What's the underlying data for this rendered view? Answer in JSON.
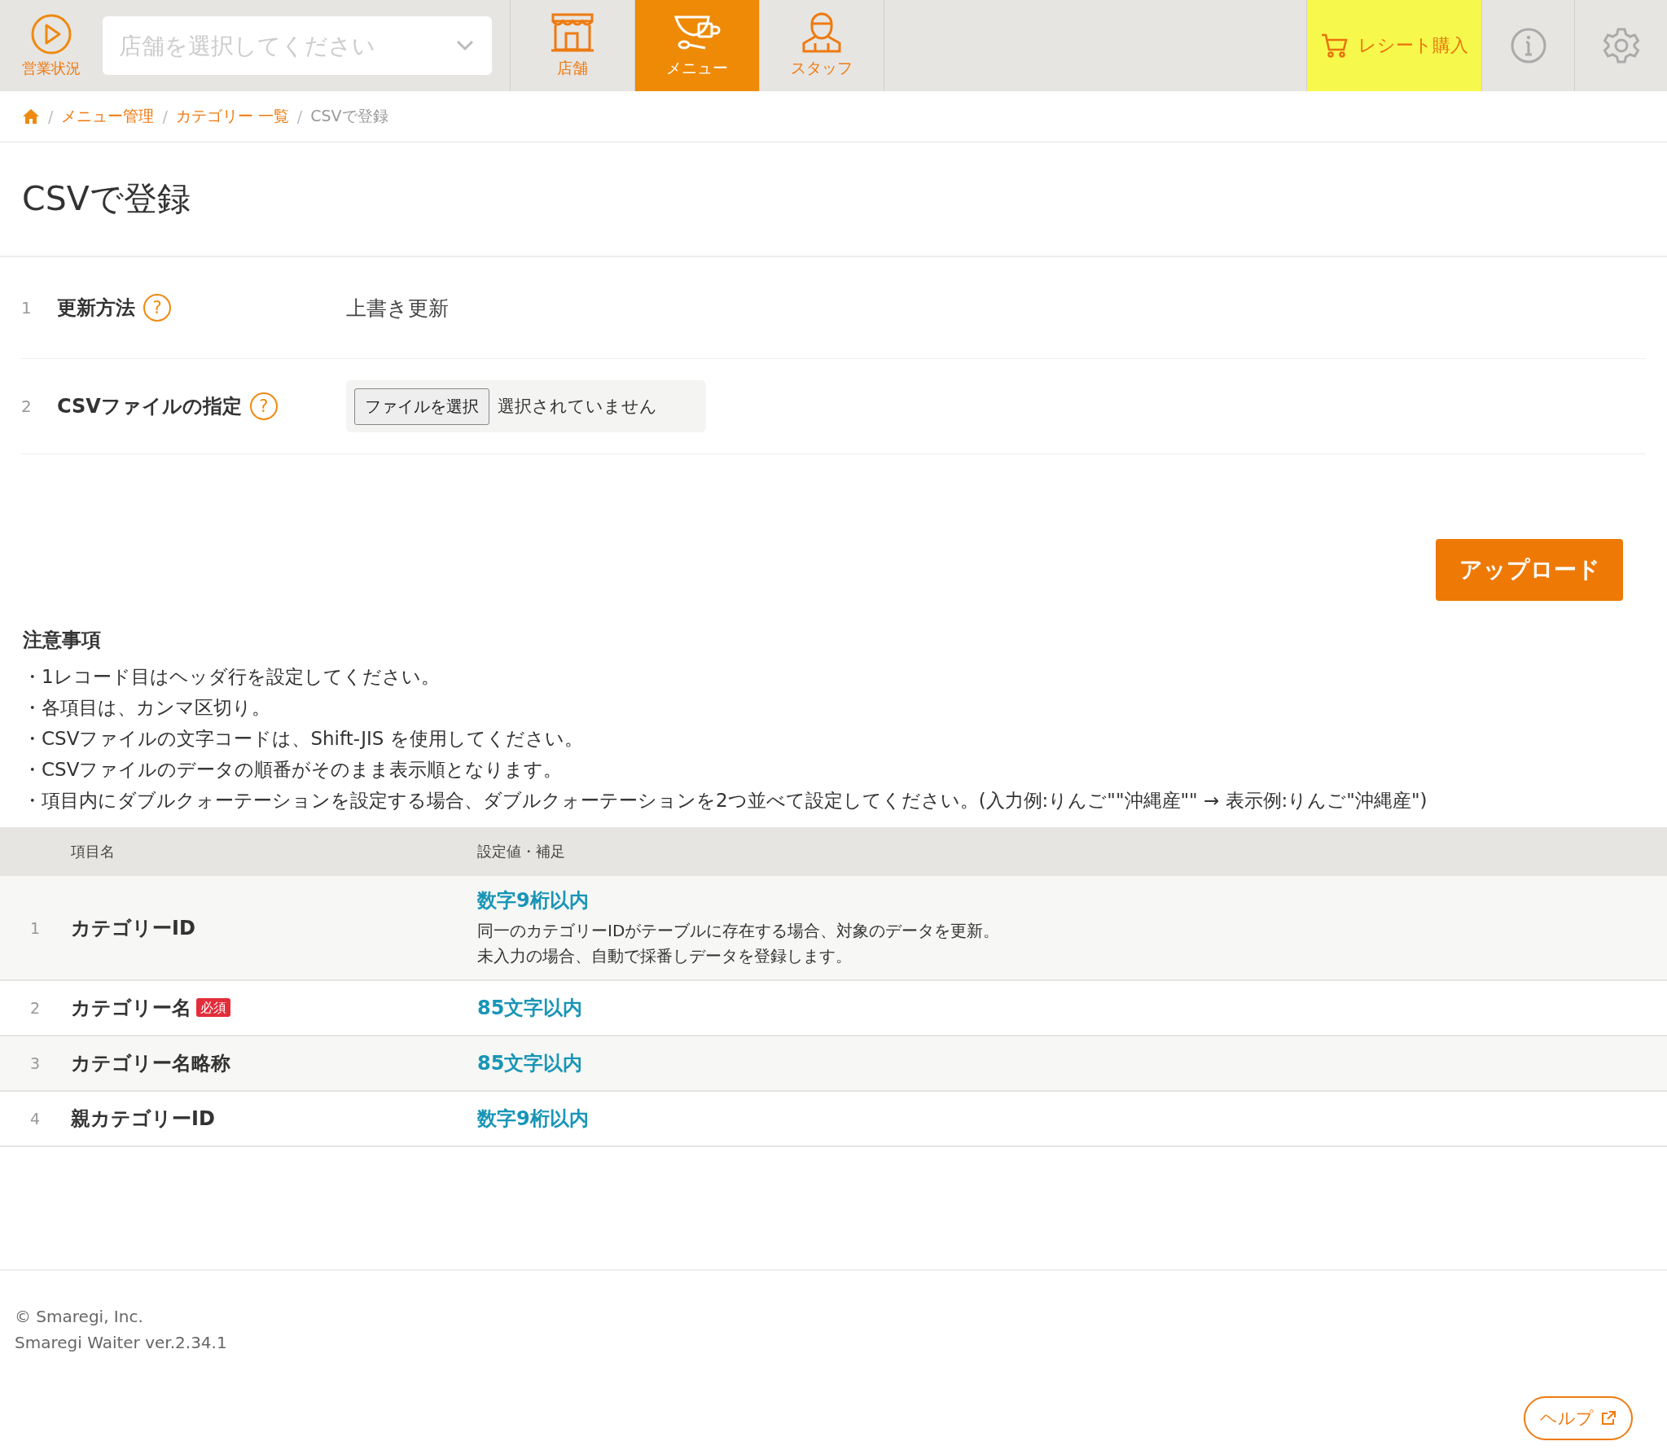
{
  "header": {
    "status_button": {
      "label": "営業状況"
    },
    "store_select": {
      "placeholder": "店舗を選択してください"
    },
    "tabs": [
      {
        "label": "店舗",
        "kind": "store",
        "selected": false
      },
      {
        "label": "メニュー",
        "kind": "menu",
        "selected": true
      },
      {
        "label": "スタッフ",
        "kind": "staff",
        "selected": false
      }
    ],
    "receipt_button": {
      "label": "レシート購入"
    }
  },
  "breadcrumb": [
    {
      "separator": "/",
      "label": "メニュー管理",
      "kind": "link"
    },
    {
      "separator": "/",
      "label": "カテゴリー 一覧",
      "kind": "link"
    },
    {
      "separator": "/",
      "label": "CSVで登録",
      "kind": "current"
    }
  ],
  "page_title": "CSVで登録",
  "form": [
    {
      "number": "1",
      "label": "更新方法",
      "help": "?",
      "kind": "text",
      "value": "上書き更新"
    },
    {
      "number": "2",
      "label": "CSVファイルの指定",
      "help": "?",
      "kind": "file",
      "button": "ファイルを選択",
      "value": "選択されていません"
    }
  ],
  "upload_button": "アップロード",
  "notes": {
    "title": "注意事項",
    "items": [
      "・1レコード目はヘッダ行を設定してください。",
      "・各項目は、カンマ区切り。",
      "・CSVファイルの文字コードは、Shift-JIS を使用してください。",
      "・CSVファイルのデータの順番がそのまま表示順となります。",
      "・項目内にダブルクォーテーションを設定する場合、ダブルクォーテーションを2つ並べて設定してください。(入力例:りんご\"\"沖縄産\"\" → 表示例:りんご\"沖縄産\")"
    ]
  },
  "table": {
    "columns": [
      "項目名",
      "設定値・補足"
    ],
    "rows": [
      {
        "number": "1",
        "name": "カテゴリーID",
        "limit": "数字9桁以内",
        "notes": [
          "同一のカテゴリーIDがテーブルに存在する場合、対象のデータを更新。",
          "未入力の場合、自動で採番しデータを登録します。"
        ]
      },
      {
        "number": "2",
        "name": "カテゴリー名",
        "badge": "必須",
        "limit": "85文字以内"
      },
      {
        "number": "3",
        "name": "カテゴリー名略称",
        "limit": "85文字以内"
      },
      {
        "number": "4",
        "name": "親カテゴリーID",
        "limit": "数字9桁以内"
      }
    ]
  },
  "footer": {
    "copyright": "© Smaregi, Inc.",
    "version": "Smaregi Waiter ver.2.34.1"
  },
  "help_button": "ヘルプ"
}
